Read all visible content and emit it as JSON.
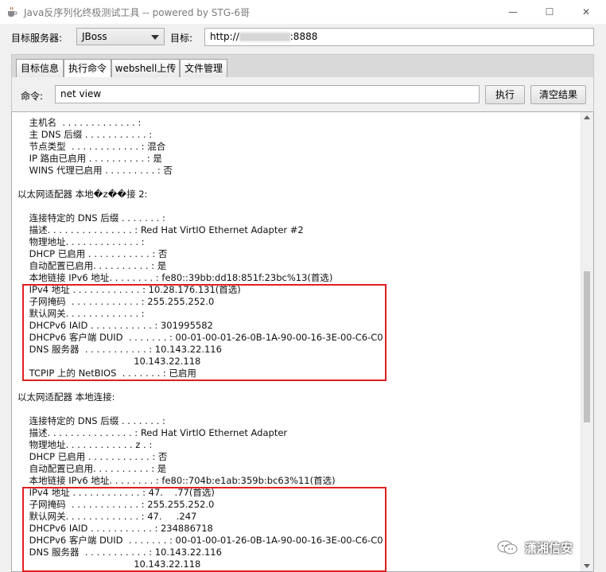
{
  "window": {
    "title": "Java反序列化终极测试工具  -- powered by STG-6哥",
    "minimize": "—",
    "maximize": "☐",
    "close": "✕"
  },
  "toolbar": {
    "server_label": "目标服务器:",
    "server_value": "JBoss",
    "target_label": "目标:",
    "url_prefix": "http://",
    "url_suffix": ":8888"
  },
  "tabs": [
    {
      "label": "目标信息"
    },
    {
      "label": "执行命令"
    },
    {
      "label": "webshell上传"
    },
    {
      "label": "文件管理"
    }
  ],
  "command": {
    "label": "命令:",
    "value": "net view",
    "execute": "执行",
    "clear": "清空结果"
  },
  "output": {
    "text": "    主机名  . . . . . . . . . . . . . :  \n    主 DNS 后缀 . . . . . . . . . . . :\n    节点类型  . . . . . . . . . . . . : 混合\n    IP 路由已启用 . . . . . . . . . . : 是\n    WINS 代理已启用 . . . . . . . . . : 否\n\n以太网适配器 本地�z��接 2:\n\n    连接特定的 DNS 后缀 . . . . . . . :\n    描述. . . . . . . . . . . . . . . : Red Hat VirtIO Ethernet Adapter #2\n    物理地址. . . . . . . . . . . . . : \n    DHCP 已启用 . . . . . . . . . . . : 否\n    自动配置已启用. . . . . . . . . . : 是\n    本地链接 IPv6 地址. . . . . . . . : fe80::39bb:dd18:851f:23bc%13(首选)\n    IPv4 地址 . . . . . . . . . . . . : 10.28.176.131(首选)\n    子网掩码  . . . . . . . . . . . . : 255.255.252.0\n    默认网关. . . . . . . . . . . . . :\n    DHCPv6 IAID . . . . . . . . . . . : 301995582\n    DHCPv6 客户端 DUID  . . . . . . . : 00-01-00-01-26-0B-1A-90-00-16-3E-00-C6-C0\n    DNS 服务器  . . . . . . . . . . . : 10.143.22.116\n                                        10.143.22.118\n    TCPIP 上的 NetBIOS  . . . . . . . : 已启用\n\n以太网适配器 本地连接:\n\n    连接特定的 DNS 后缀 . . . . . . . :\n    描述. . . . . . . . . . . . . . . : Red Hat VirtIO Ethernet Adapter\n    物理地址. . . . . . . . . . . . z . : \n    DHCP 已启用 . . . . . . . . . . . : 否\n    自动配置已启用. . . . . . . . . . : 是\n    本地链接 IPv6 地址. . . . . . . . : fe80::704b:e1ab:359b:bc63%11(首选)\n    IPv4 地址 . . . . . . . . . . . . : 47.    .77(首选)\n    子网掩码  . . . . . . . . . . . . : 255.255.252.0\n    默认网关. . . . . . . . . . . . . : 47.     .247\n    DHCPv6 IAID . . . . . . . . . . . : 234886718\n    DHCPv6 客户端 DUID  . . . . . . . : 00-01-00-01-26-0B-1A-90-00-16-3E-00-C6-C0\n    DNS 服务器  . . . . . . . . . . . : 10.143.22.116\n                                        10.143.22.118"
  },
  "watermark": {
    "text": "潇湘信安"
  },
  "colors": {
    "highlight": "#e02020",
    "window_bg": "#f0f0f0"
  }
}
